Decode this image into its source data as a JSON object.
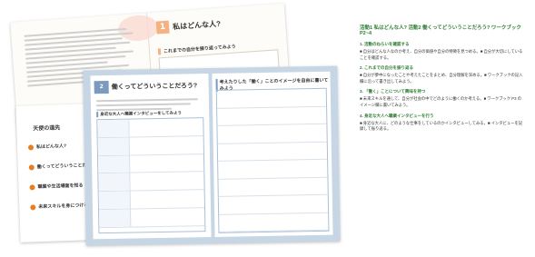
{
  "spread1": {
    "number": "1",
    "title": "私はどんな人?",
    "subheading": "これまでの自分を振り返ってみよう"
  },
  "page2": {
    "title": "天使の道先",
    "rows": [
      "私はどんな人?",
      "働くってどういうことだろう?",
      "職業や生活場面を知る",
      "未来スキルを身につける"
    ]
  },
  "spread2": {
    "number": "2",
    "title": "働くってどういうことだろう?",
    "left_sub": "身近な大人へ職業インタビューをしてみよう",
    "right_sub": "考えたりした「働く」ことのイメージを自由に書いてみよう"
  },
  "doc": {
    "title": "活動1 私はどんな人?     活動2 働くってどういうことだろう?     ワークブック P2~4",
    "sections": [
      {
        "heading": "1. 活動のねらいを確認する",
        "body": "■ 自分はどんな人なのか考え、自分の価値や自分の特徴を見つめる。■ 自分が大切にしていることを確認する。"
      },
      {
        "heading": "2. これまでの自分を振り返る",
        "body": "■ 自分が夢中になったことや考えたことをまとめ、自分理解を深める。■ ワークブックの記入欄に沿って書き出してみよう。"
      },
      {
        "heading": "3. 「働く」ことについて興味を持つ",
        "body": "■ 未来スキルを通して、自分が社会の中でどのように働くのか考える。■ ワークブック P3 のイメージ欄に書いてみよう。"
      },
      {
        "heading": "4. 身近な大人へ職業インタビューを行う",
        "body": "■ 身近な大人に、どのような仕事をしているのかインタビューしてみる。■ インタビューを記録して振り返る。"
      }
    ]
  }
}
